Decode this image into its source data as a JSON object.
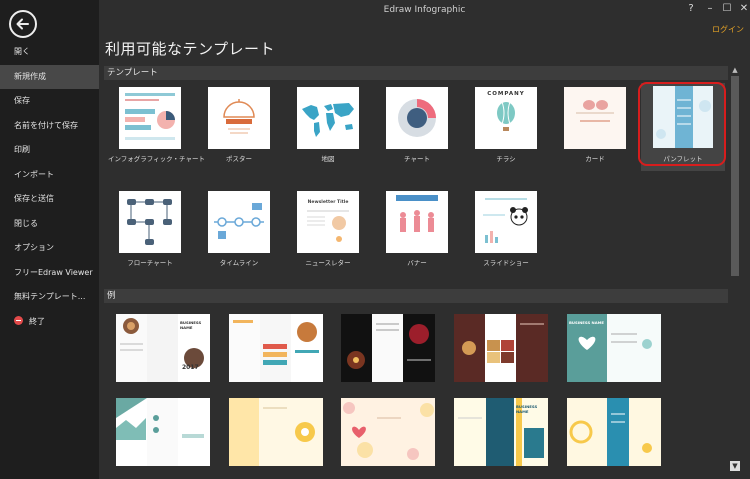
{
  "window": {
    "title": "Edraw Infographic",
    "login_label": "ログイン"
  },
  "sidebar": {
    "items": [
      {
        "label": "開く",
        "active": false
      },
      {
        "label": "新規作成",
        "active": true
      },
      {
        "label": "保存",
        "active": false
      },
      {
        "label": "名前を付けて保存",
        "active": false
      },
      {
        "label": "印刷",
        "active": false
      },
      {
        "label": "インポート",
        "active": false
      },
      {
        "label": "保存と送信",
        "active": false
      },
      {
        "label": "閉じる",
        "active": false
      },
      {
        "label": "オプション",
        "active": false
      },
      {
        "label": "フリーEdraw Viewer",
        "active": false
      },
      {
        "label": "無料テンプレート...",
        "active": false
      },
      {
        "label": "終了",
        "active": false
      }
    ]
  },
  "main": {
    "heading": "利用可能なテンプレート",
    "templates_section": "テンプレート",
    "examples_section": "例",
    "templates": [
      {
        "label": "インフォグラフィック・チャート"
      },
      {
        "label": "ポスター"
      },
      {
        "label": "地図"
      },
      {
        "label": "チャート"
      },
      {
        "label": "チラシ"
      },
      {
        "label": "カード"
      },
      {
        "label": "パンフレット"
      },
      {
        "label": "フローチャート"
      },
      {
        "label": "タイムライン"
      },
      {
        "label": "ニュースレター"
      },
      {
        "label": "バナー"
      },
      {
        "label": "スライドショー"
      }
    ],
    "thumb_text": {
      "company": "COMPANY",
      "newsletter": "Newsletter Title",
      "business_name": "BUSINESS NAME",
      "year": "2017"
    }
  },
  "colors": {
    "accent": "#e2a126",
    "highlight": "#d71d1d",
    "teal": "#5aa9c2"
  }
}
